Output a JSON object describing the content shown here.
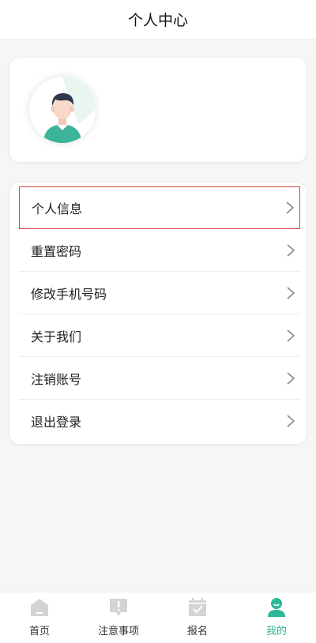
{
  "header": {
    "title": "个人中心"
  },
  "menu": {
    "items": [
      {
        "label": "个人信息"
      },
      {
        "label": "重置密码"
      },
      {
        "label": "修改手机号码"
      },
      {
        "label": "关于我们"
      },
      {
        "label": "注销账号"
      },
      {
        "label": "退出登录"
      }
    ]
  },
  "tabbar": {
    "tabs": [
      {
        "label": "首页",
        "icon": "home-icon"
      },
      {
        "label": "注意事项",
        "icon": "notice-icon"
      },
      {
        "label": "报名",
        "icon": "calendar-check-icon"
      },
      {
        "label": "我的",
        "icon": "user-icon"
      }
    ],
    "active_color": "#2bb89a",
    "inactive_icon_color": "#d4d4d4"
  }
}
